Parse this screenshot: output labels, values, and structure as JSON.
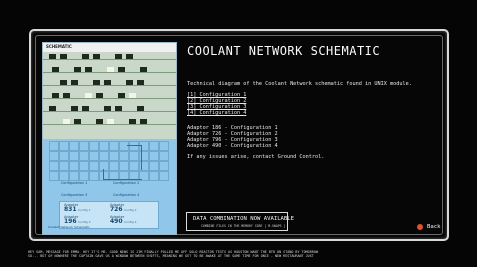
{
  "title": "COOLANT NETWORK SCHEMATIC",
  "description": "Technical diagram of the Coolant Network schematic found in UNIX module.",
  "configurations": [
    "[1] Configuration 1",
    "[2] Configuration 2",
    "[3] Configuration 3",
    "[4] Configuration 4"
  ],
  "adapters": [
    "Adaptor 186 - Configuration 1",
    "Adaptor 726 - Configuration 2",
    "Adaptor 796 - Configuration 3",
    "Adaptor 490 - Configuration 4"
  ],
  "contact_note": "If any issues arise, contact Ground Control.",
  "combo_box": {
    "title": "DATA COMBINATION NOW AVAILABLE",
    "subtitle": "COMBINE FILES IN THE MEMORY CORE [ M-SWAPS ]"
  },
  "back_label": "Back",
  "ticker_lines": [
    "HEY SAM, MESSAGE FOR EMMA. HEY IT'S ME. GOOD NEWS IS JIM FINALLY PULLED ME OFF SOLO REACTOR TESTS AS HOUSTON WANT THE BTR ON STAND BY TOMORROW",
    "SO... BUT OF NOWHERE THE CAPTAIN GAVE US A WINDOW BETWEEN SHIFTS, MEANING WE GET TO BE AWAKE AT THE SAME TIME FOR ONCE - NEW RESTAURANT JUST"
  ],
  "schematic": {
    "header": "SCHEMATIC",
    "configuration_labels": [
      "Configuration 1",
      "Configuration 2",
      "Configuration 3",
      "Configuration 4"
    ],
    "adapters": [
      {
        "label": "Adapter",
        "value": "831",
        "sub": "Config 1"
      },
      {
        "label": "Adapter",
        "value": "726",
        "sub": "Config 2"
      },
      {
        "label": "Adapter",
        "value": "196",
        "sub": "Config 3"
      },
      {
        "label": "Adapter",
        "value": "490",
        "sub": "Config 4"
      }
    ],
    "footnote": "Coolant Network Schematic"
  },
  "colors": {
    "accent_back": "#e0522d",
    "schematic_blue": "#8fc6ea",
    "schematic_green": "#c9d8c8"
  }
}
